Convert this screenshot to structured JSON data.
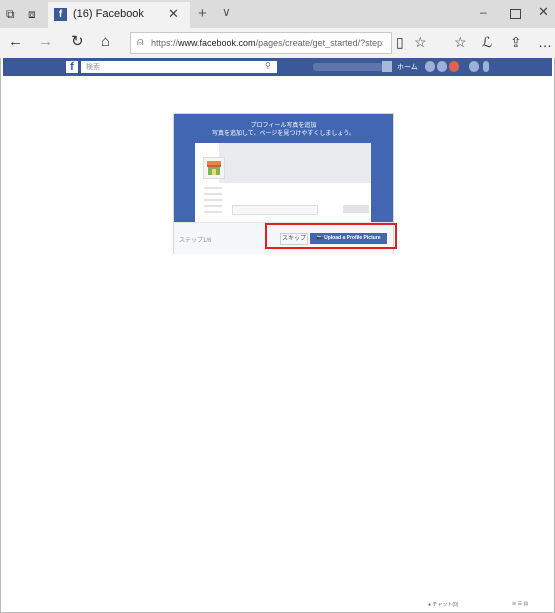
{
  "browser": {
    "tab_title": "(16) Facebook",
    "fb_favicon": "f",
    "icons": {
      "tab_preview": "⧉",
      "back_tabs": "⧈",
      "close": "✕",
      "new_tab": "+",
      "tab_list": "∨",
      "minimize": "–",
      "window_close": "✕",
      "back": "←",
      "forward": "→",
      "refresh": "↻",
      "home": "⌂",
      "lock": "⍝",
      "reading": "▯",
      "star": "☆",
      "favorites": "☆",
      "pen": "ℒ",
      "share": "⇪",
      "more": "…"
    },
    "url_prefix": "https://",
    "url_host": "www.facebook.com",
    "url_path": "/pages/create/get_started/?step=j"
  },
  "fb": {
    "logo": "f",
    "search_placeholder": "検索",
    "search_icon": "⚲",
    "home": "ホーム"
  },
  "dialog": {
    "title": "プロフィール写真を追加",
    "subtitle": "写真を追加して、ページを見つけやすくしましょう。",
    "step": "ステップ1/6",
    "skip": "スキップ",
    "upload": "Upload a Profile Picture",
    "camera_icon": "📷"
  },
  "status": {
    "chat": "● チャット(0)",
    "right": "⊕ ☰ ▤"
  },
  "colors": {
    "fb_blue": "#3b5998",
    "button_blue": "#4267b2",
    "highlight": "#e02020"
  }
}
